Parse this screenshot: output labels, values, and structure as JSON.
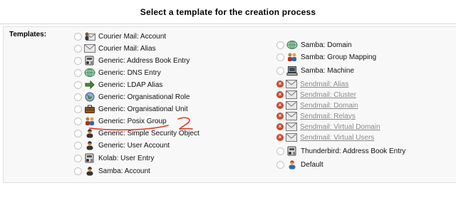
{
  "header": {
    "title": "Select a template for the creation process"
  },
  "templates_label": "Templates:",
  "left_items": [
    {
      "label": "Courier Mail: Account",
      "icon": "mail-user-icon",
      "disabled": false
    },
    {
      "label": "Courier Mail: Alias",
      "icon": "mail-icon",
      "disabled": false
    },
    {
      "label": "Generic: Address Book Entry",
      "icon": "address-book-icon",
      "disabled": false
    },
    {
      "label": "Generic: DNS Entry",
      "icon": "dns-globe-icon",
      "disabled": false
    },
    {
      "label": "Generic: LDAP Alias",
      "icon": "arrow-right-icon",
      "disabled": false
    },
    {
      "label": "Generic: Organisational Role",
      "icon": "globe-role-icon",
      "disabled": false
    },
    {
      "label": "Generic: Organisational Unit",
      "icon": "briefcase-icon",
      "disabled": false
    },
    {
      "label": "Generic: Posix Group",
      "icon": "group-icon",
      "disabled": false
    },
    {
      "label": "Generic: Simple Security Object",
      "icon": "user-icon",
      "disabled": false
    },
    {
      "label": "Generic: User Account",
      "icon": "user-icon",
      "disabled": false
    },
    {
      "label": "Kolab: User Entry",
      "icon": "address-book-icon",
      "disabled": false
    },
    {
      "label": "Samba: Account",
      "icon": "user-icon",
      "disabled": false
    }
  ],
  "right_items": [
    {
      "label": "Samba: Domain",
      "icon": "dns-globe-icon",
      "disabled": false
    },
    {
      "label": "Samba: Group Mapping",
      "icon": "group-icon",
      "disabled": false
    },
    {
      "label": "Samba: Machine",
      "icon": "computer-icon",
      "disabled": false
    },
    {
      "label": "Sendmail: Alias",
      "icon": "mail-icon",
      "disabled": true
    },
    {
      "label": "Sendmail: Cluster",
      "icon": "mail-icon",
      "disabled": true
    },
    {
      "label": "Sendmail: Domain",
      "icon": "mail-icon",
      "disabled": true
    },
    {
      "label": "Sendmail: Relays",
      "icon": "mail-icon",
      "disabled": true
    },
    {
      "label": "Sendmail: Virtual Domain",
      "icon": "mail-icon",
      "disabled": true
    },
    {
      "label": "Sendmail: Virtual Users",
      "icon": "mail-icon",
      "disabled": true
    },
    {
      "label": "Thunderbird: Address Book Entry",
      "icon": "address-book-icon",
      "disabled": false
    },
    {
      "label": "Default",
      "icon": "default-user-icon",
      "disabled": false
    }
  ],
  "colors": {
    "panel_bg": "#f8f8f8",
    "disabled_marker": "#c84a2a",
    "annotation": "#e03a20",
    "disabled_text": "#8a8a8a"
  }
}
